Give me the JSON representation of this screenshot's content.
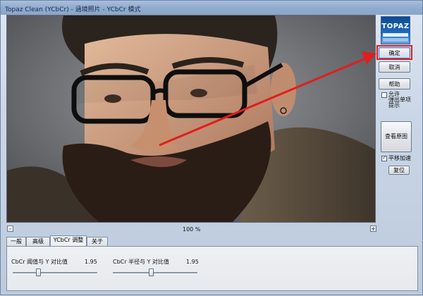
{
  "window": {
    "title": "Topaz Clean (YCbCr) - 涵境照片 - YCbCr 模式"
  },
  "logo": {
    "text": "TOPAZ"
  },
  "buttons": {
    "ok": "确定",
    "cancel": "取消",
    "help": "帮助",
    "view_original": "查看原图",
    "reset": "复位"
  },
  "options": {
    "allow_tips_label": "允许\n弹出单项\n提示",
    "allow_tips_checked": false,
    "pan_accel_label": "平移加速",
    "pan_accel_checked": true
  },
  "zoom": {
    "level": "100 %",
    "minus": "-",
    "plus": "+"
  },
  "tabs": [
    {
      "label": "一般",
      "active": false
    },
    {
      "label": "高级",
      "active": false
    },
    {
      "label": "YCbCr 调整",
      "active": true
    },
    {
      "label": "关于",
      "active": false
    }
  ],
  "sliders": [
    {
      "label": "CbCr 阈值与 Y 对比值",
      "value": "1.95",
      "level": 0.3
    },
    {
      "label": "CbCr 半径与 Y 对比值",
      "value": "1.95",
      "level": 0.45
    }
  ],
  "colors": {
    "annotation_red": "#e21d1d",
    "accent_blue": "#3d7bd8"
  }
}
